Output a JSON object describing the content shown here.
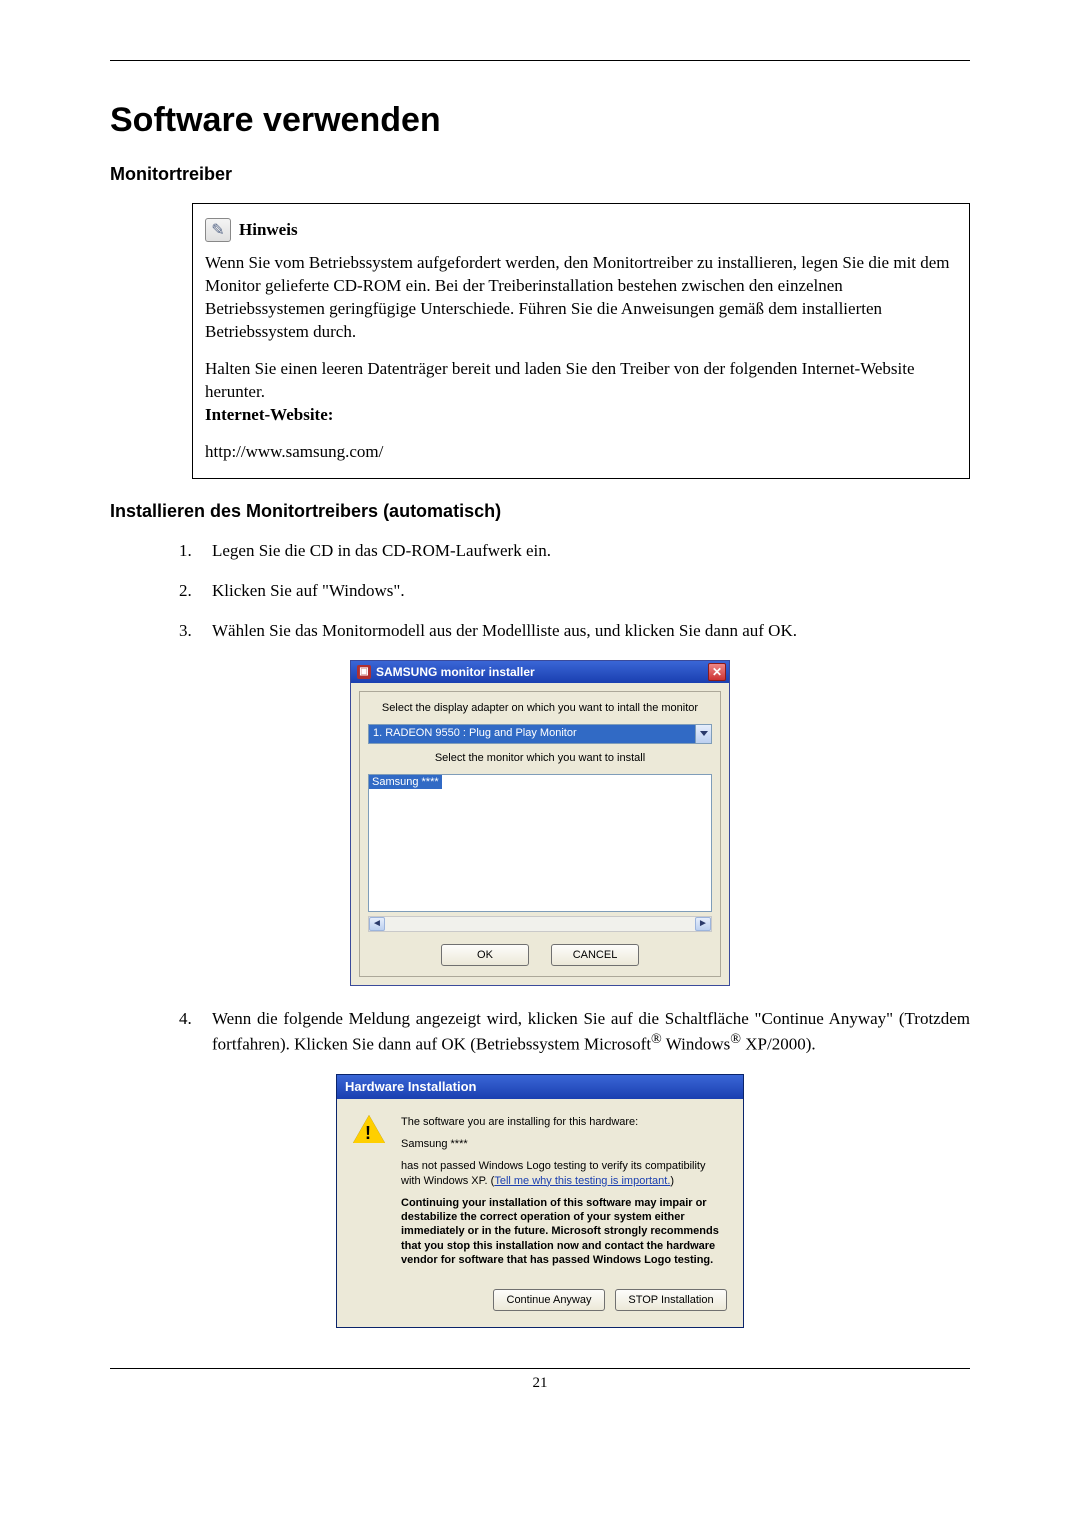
{
  "page_number": "21",
  "heading": "Software verwenden",
  "section1_title": "Monitortreiber",
  "hinweis": {
    "title": "Hinweis",
    "para1": "Wenn Sie vom Betriebssystem aufgefordert werden, den Monitortreiber zu installieren, legen Sie die mit dem Monitor gelieferte CD-ROM ein. Bei der Treiberinstallation bestehen zwischen den einzelnen Betriebssystemen geringfügige Unterschiede. Führen Sie die Anweisungen gemäß dem installierten Betriebssystem durch.",
    "para2": "Halten Sie einen leeren Datenträger bereit und laden Sie den Treiber von der folgenden Internet-Website herunter.",
    "label_website": "Internet-Website:",
    "url": "http://www.samsung.com/"
  },
  "section2_title": "Installieren des Monitortreibers (automatisch)",
  "steps": {
    "s1": "Legen Sie die CD in das CD-ROM-Laufwerk ein.",
    "s2": "Klicken Sie auf \"Windows\".",
    "s3": "Wählen Sie das Monitormodell aus der Modellliste aus, und klicken Sie dann auf OK.",
    "s4a": "Wenn die folgende Meldung angezeigt wird, klicken Sie auf die Schaltfläche \"Continue Anyway\" (Trotzdem fortfahren). Klicken Sie dann auf OK (Betriebssystem Microsoft",
    "s4b": " Windows",
    "s4c": " XP/2000)."
  },
  "samsung_dialog": {
    "title": "SAMSUNG monitor installer",
    "line1": "Select the display adapter on which you want to intall the monitor",
    "dropdown_selected": "1. RADEON 9550 : Plug and Play Monitor",
    "line2": "Select the monitor which you want to install",
    "list_selected": "Samsung ****",
    "ok": "OK",
    "cancel": "CANCEL"
  },
  "hw_dialog": {
    "title": "Hardware Installation",
    "intro": "The software you are installing for this hardware:",
    "device": "Samsung ****",
    "compat_a": "has not passed Windows Logo testing to verify its compatibility with Windows XP. (",
    "compat_link": "Tell me why this testing is important.",
    "compat_b": ")",
    "warn": "Continuing your installation of this software may impair or destabilize the correct operation of your system either immediately or in the future. Microsoft strongly recommends that you stop this installation now and contact the hardware vendor for software that has passed Windows Logo testing.",
    "btn_continue": "Continue Anyway",
    "btn_stop": "STOP Installation"
  }
}
